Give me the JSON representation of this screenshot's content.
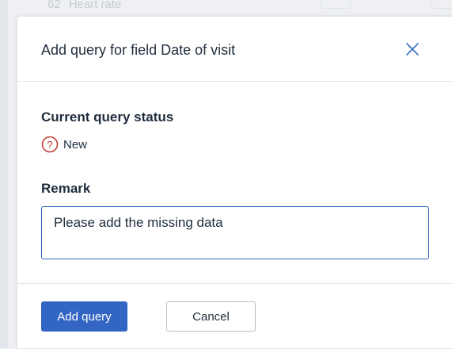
{
  "background": {
    "row_label": "Heart rate",
    "row_prefix": "62"
  },
  "modal": {
    "title": "Add query for field Date of visit",
    "current_status": {
      "heading": "Current query status",
      "status_label": "New",
      "status_icon": "question-circle-icon",
      "status_color": "#c0392b"
    },
    "remark": {
      "heading": "Remark",
      "value": "Please add the missing data"
    },
    "buttons": {
      "add_query": "Add query",
      "cancel": "Cancel"
    },
    "colors": {
      "primary": "#3366c4",
      "input_border": "#2b62b8",
      "close_icon": "#3b6fc4"
    }
  }
}
